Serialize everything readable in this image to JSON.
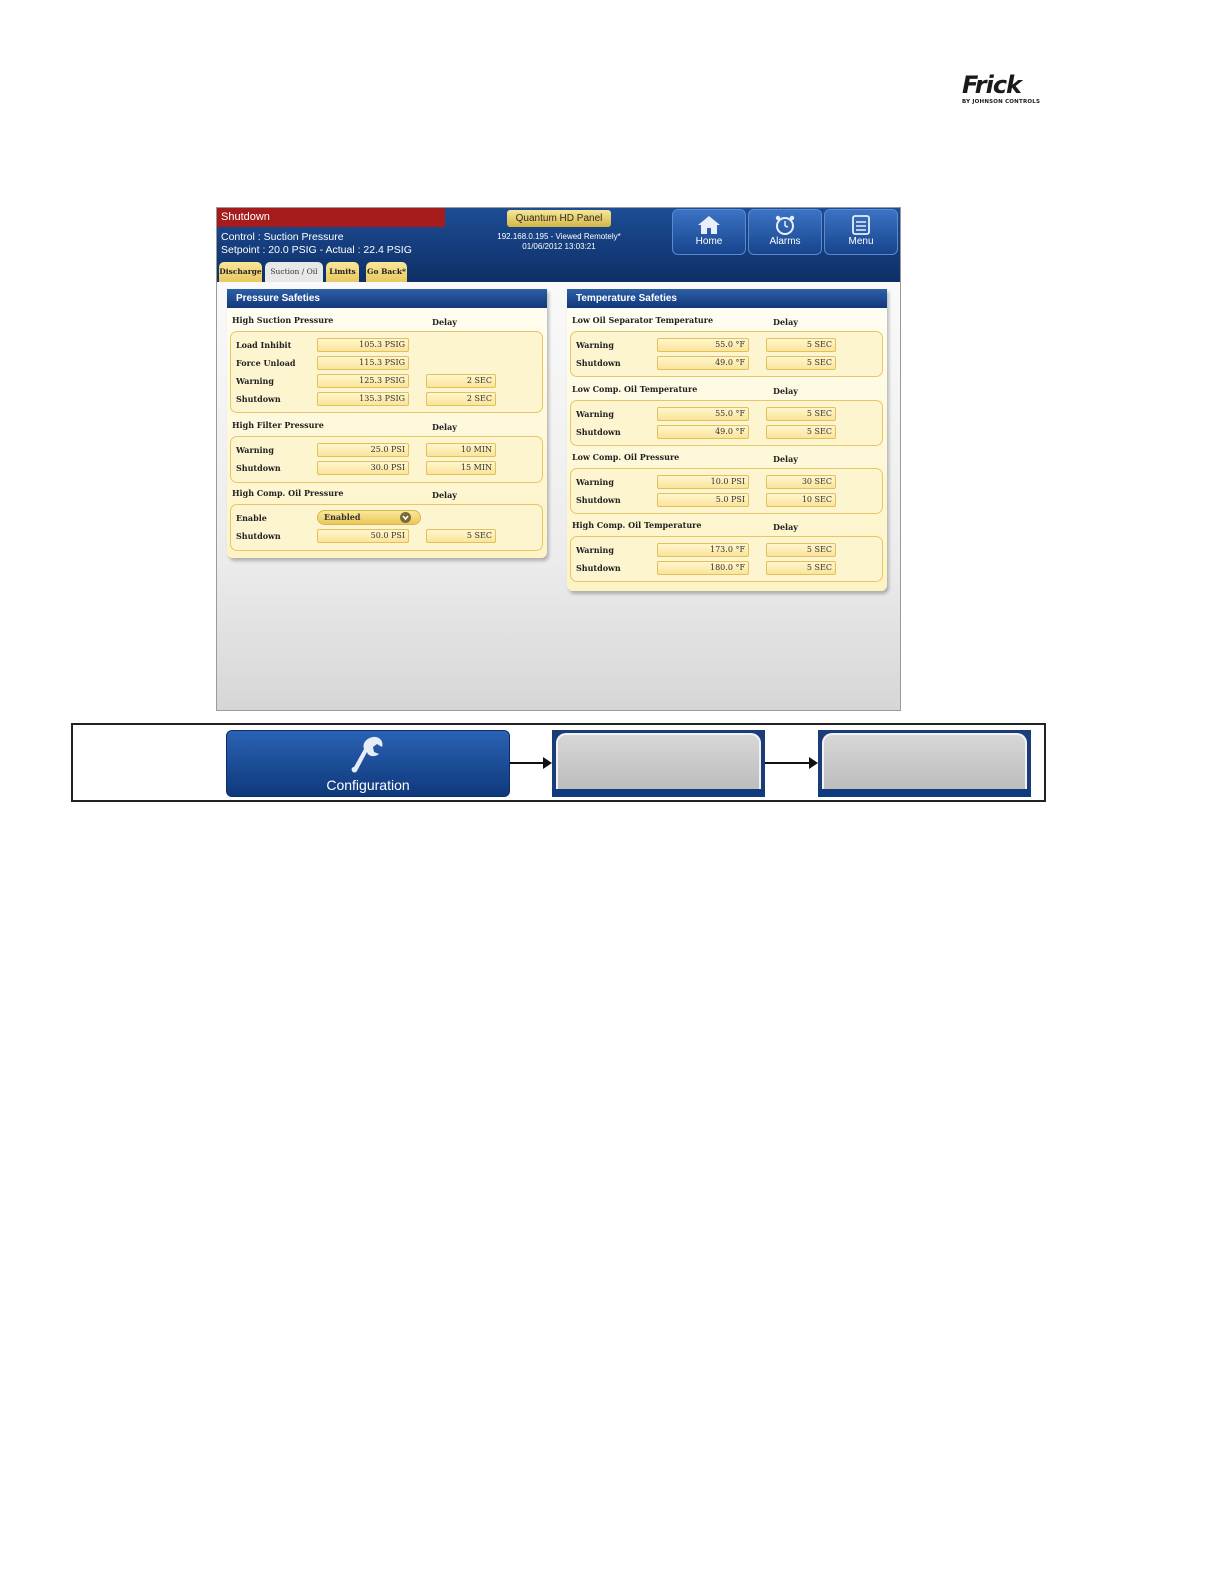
{
  "logo": {
    "brand": "Frick",
    "sub": "BY JOHNSON CONTROLS"
  },
  "header": {
    "status": "Shutdown",
    "control": "Control : Suction Pressure",
    "setpoint": "Setpoint : 20.0 PSIG - Actual : 22.4 PSIG",
    "panel_title": "Quantum HD Panel",
    "ip_line": "192.168.0.195 - Viewed Remotely*",
    "datetime": "01/06/2012 13:03:21",
    "nav": {
      "home": "Home",
      "alarms": "Alarms",
      "menu": "Menu"
    }
  },
  "tabs": [
    "Discharge",
    "Suction / Oil",
    "Limits",
    "Go Back*"
  ],
  "pressure": {
    "title": "Pressure Safeties",
    "delay": "Delay",
    "high_suction": {
      "title": "High Suction Pressure",
      "rows": [
        {
          "label": "Load Inhibit",
          "value": "105.3 PSIG",
          "delay": ""
        },
        {
          "label": "Force Unload",
          "value": "115.3 PSIG",
          "delay": ""
        },
        {
          "label": "Warning",
          "value": "125.3 PSIG",
          "delay": "2 SEC"
        },
        {
          "label": "Shutdown",
          "value": "135.3 PSIG",
          "delay": "2 SEC"
        }
      ]
    },
    "high_filter": {
      "title": "High Filter Pressure",
      "rows": [
        {
          "label": "Warning",
          "value": "25.0 PSI",
          "delay": "10 MIN"
        },
        {
          "label": "Shutdown",
          "value": "30.0 PSI",
          "delay": "15 MIN"
        }
      ]
    },
    "high_comp_oil": {
      "title": "High Comp. Oil Pressure",
      "enable_label": "Enable",
      "enable_value": "Enabled",
      "shutdown_label": "Shutdown",
      "shutdown_value": "50.0 PSI",
      "shutdown_delay": "5 SEC"
    }
  },
  "temperature": {
    "title": "Temperature Safeties",
    "delay": "Delay",
    "groups": [
      {
        "title": "Low Oil Separator Temperature",
        "rows": [
          {
            "label": "Warning",
            "value": "55.0 °F",
            "delay": "5 SEC"
          },
          {
            "label": "Shutdown",
            "value": "49.0 °F",
            "delay": "5 SEC"
          }
        ]
      },
      {
        "title": "Low Comp. Oil Temperature",
        "rows": [
          {
            "label": "Warning",
            "value": "55.0 °F",
            "delay": "5 SEC"
          },
          {
            "label": "Shutdown",
            "value": "49.0 °F",
            "delay": "5 SEC"
          }
        ]
      },
      {
        "title": "Low Comp. Oil Pressure",
        "rows": [
          {
            "label": "Warning",
            "value": "10.0 PSI",
            "delay": "30 SEC"
          },
          {
            "label": "Shutdown",
            "value": "5.0 PSI",
            "delay": "10 SEC"
          }
        ]
      },
      {
        "title": "High Comp. Oil Temperature",
        "rows": [
          {
            "label": "Warning",
            "value": "173.0 °F",
            "delay": "5 SEC"
          },
          {
            "label": "Shutdown",
            "value": "180.0 °F",
            "delay": "5 SEC"
          }
        ]
      }
    ]
  },
  "navpath": {
    "config_label": "Configuration",
    "icon": "wrench-icon"
  },
  "colors": {
    "header_blue": "#12387a",
    "status_red": "#a61c1c",
    "field_yellow": "#fbe49a"
  }
}
